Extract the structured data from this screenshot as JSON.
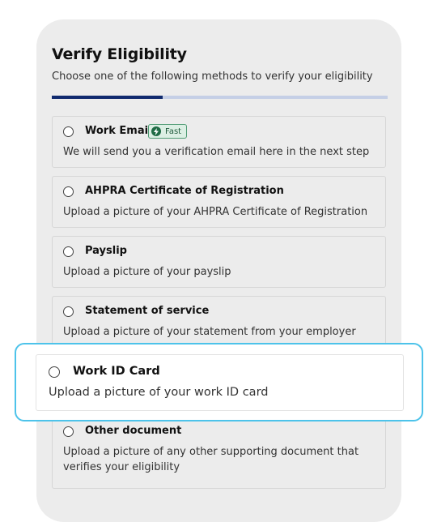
{
  "header": {
    "title": "Verify Eligibility",
    "subtitle": "Choose one of the following methods to verify your eligibility"
  },
  "progress": {
    "fraction": 0.33,
    "fill_color": "#102a6e",
    "track_color": "#c5cfe6"
  },
  "badge": {
    "label": "Fast",
    "icon": "lightning-bolt-icon"
  },
  "options": [
    {
      "title": "Work Email",
      "description": "We will send you a verification email here in the next step"
    },
    {
      "title": "AHPRA Certificate of Registration",
      "description": "Upload a picture of your AHPRA Certificate of Registration"
    },
    {
      "title": "Payslip",
      "description": "Upload a picture of your payslip"
    },
    {
      "title": "Statement of service",
      "description": "Upload a picture of your statement from your employer"
    },
    {
      "title": "Work ID Card",
      "description": "Upload a picture of your work ID card"
    },
    {
      "title": "Other document",
      "description": "Upload a picture of any other supporting document that verifies your eligibility"
    }
  ],
  "highlight_color": "#4dc3ea"
}
